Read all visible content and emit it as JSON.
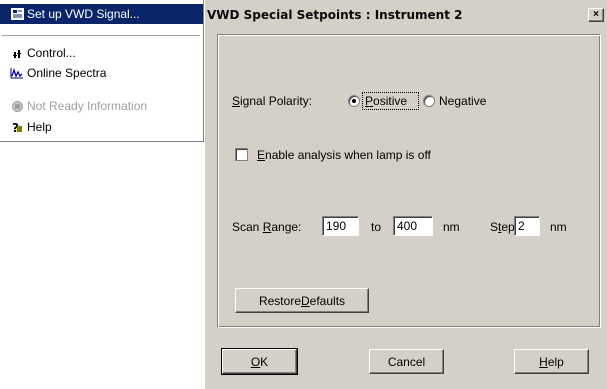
{
  "menu": {
    "items": [
      {
        "label": "Set up VWD Signal...",
        "icon": "signal-setup-icon",
        "selected": true,
        "disabled": false
      },
      {
        "label": "Control...",
        "icon": "control-icon",
        "selected": false,
        "disabled": false
      },
      {
        "label": "Online Spectra",
        "icon": "spectra-icon",
        "selected": false,
        "disabled": false
      },
      {
        "label": "Not Ready Information",
        "icon": "not-ready-icon",
        "selected": false,
        "disabled": true
      },
      {
        "label": "Help",
        "icon": "help-icon",
        "selected": false,
        "disabled": false
      }
    ]
  },
  "dialog": {
    "title": "VWD Special Setpoints : Instrument 2",
    "close_glyph": "×",
    "signal_polarity": {
      "label": "Signal Polarity:",
      "positive_label": "Positive",
      "negative_label": "Negative",
      "selected": "Positive"
    },
    "enable_analysis": {
      "label": "Enable analysis when lamp is off",
      "checked": false
    },
    "scan_range": {
      "label": "Scan Range:",
      "from_value": "190",
      "to_label": "to",
      "to_value": "400",
      "unit": "nm",
      "step_label": "Step",
      "step_value": "2",
      "step_unit": "nm"
    },
    "restore_defaults_label": "Restore Defaults",
    "buttons": {
      "ok": "OK",
      "cancel": "Cancel",
      "help": "Help"
    }
  },
  "colors": {
    "selection": "#0a246a",
    "dialog_face": "#d4d0c8"
  }
}
